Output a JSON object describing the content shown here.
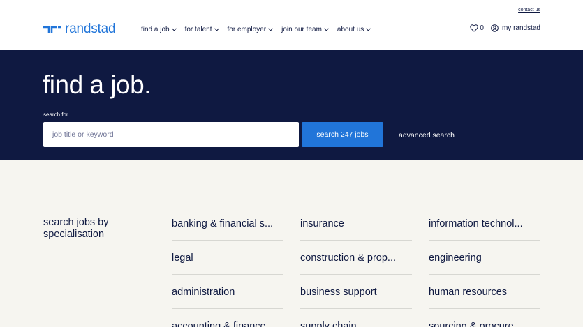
{
  "header": {
    "contact_link": "contact us",
    "logo_text": "randstad",
    "nav": [
      {
        "label": "find a job"
      },
      {
        "label": "for talent"
      },
      {
        "label": "for employer"
      },
      {
        "label": "join our team"
      },
      {
        "label": "about us"
      }
    ],
    "favorites_count": "0",
    "account_label": "my randstad"
  },
  "hero": {
    "title": "find a job.",
    "search_label": "search for",
    "search_placeholder": "job title or keyword",
    "search_value": "",
    "search_button": "search 247 jobs",
    "advanced_search": "advanced search"
  },
  "specialisations": {
    "heading": "search jobs by specialisation",
    "items": [
      "banking & financial s...",
      "insurance",
      "information technol...",
      "legal",
      "construction & prop...",
      "engineering",
      "administration",
      "business support",
      "human resources",
      "accounting & finance",
      "supply chain",
      "sourcing & procure..."
    ]
  },
  "colors": {
    "brand_blue": "#2175d9",
    "navy": "#0f1941",
    "page_bg": "#f6f5f0"
  }
}
